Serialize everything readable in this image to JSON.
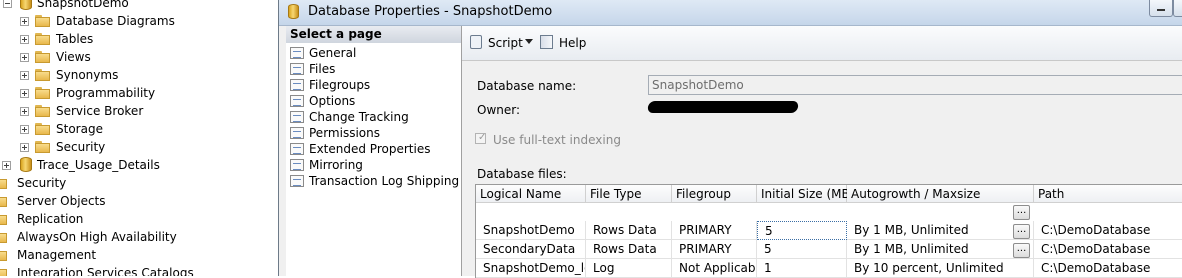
{
  "tree": {
    "items": [
      {
        "label": "SnapshotDemo",
        "icon": "database-icon",
        "expander": "minus"
      },
      {
        "label": "Database Diagrams",
        "icon": "folder-icon",
        "expander": "plus"
      },
      {
        "label": "Tables",
        "icon": "folder-icon",
        "expander": "plus"
      },
      {
        "label": "Views",
        "icon": "folder-icon",
        "expander": "plus"
      },
      {
        "label": "Synonyms",
        "icon": "folder-icon",
        "expander": "plus"
      },
      {
        "label": "Programmability",
        "icon": "folder-icon",
        "expander": "plus"
      },
      {
        "label": "Service Broker",
        "icon": "folder-icon",
        "expander": "plus"
      },
      {
        "label": "Storage",
        "icon": "folder-icon",
        "expander": "plus"
      },
      {
        "label": "Security",
        "icon": "folder-icon",
        "expander": "plus"
      },
      {
        "label": "Trace_Usage_Details",
        "icon": "database-icon",
        "expander": "plus"
      },
      {
        "label": "Security",
        "icon": "folder-icon",
        "expander": "none"
      },
      {
        "label": "Server Objects",
        "icon": "folder-icon",
        "expander": "none"
      },
      {
        "label": "Replication",
        "icon": "folder-icon",
        "expander": "none"
      },
      {
        "label": "AlwaysOn High Availability",
        "icon": "folder-icon",
        "expander": "none"
      },
      {
        "label": "Management",
        "icon": "folder-icon",
        "expander": "none"
      },
      {
        "label": "Integration Services Catalogs",
        "icon": "folder-icon",
        "expander": "none"
      }
    ]
  },
  "dialog": {
    "title": "Database Properties - SnapshotDemo",
    "select_page_header": "Select a page",
    "pages": [
      "General",
      "Files",
      "Filegroups",
      "Options",
      "Change Tracking",
      "Permissions",
      "Extended Properties",
      "Mirroring",
      "Transaction Log Shipping"
    ],
    "toolbar": {
      "script_label": "Script",
      "help_label": "Help"
    },
    "database_name_label": "Database name:",
    "database_name_value": "SnapshotDemo",
    "owner_label": "Owner:",
    "fulltext_label": "Use full-text indexing",
    "fulltext_checked": true,
    "files_label": "Database files:",
    "columns": [
      "Logical Name",
      "File Type",
      "Filegroup",
      "Initial Size (MB)",
      "Autogrowth / Maxsize",
      "Path"
    ],
    "rows": [
      [
        "SnapshotDemo",
        "Rows Data",
        "PRIMARY",
        "5",
        "By 1 MB, Unlimited",
        "C:\\DemoDatabase"
      ],
      [
        "SecondaryData",
        "Rows Data",
        "PRIMARY",
        "5",
        "By 1 MB, Unlimited",
        "C:\\DemoDatabase"
      ],
      [
        "SnapshotDemo_log",
        "Log",
        "Not Applicable",
        "1",
        "By 10 percent, Unlimited",
        "C:\\DemoDatabase"
      ]
    ],
    "ellipsis_label": "..."
  },
  "colors": {
    "folder": "#e8b84c",
    "titlebar": "#c5d6ea",
    "selection": "#3a6ea5"
  }
}
